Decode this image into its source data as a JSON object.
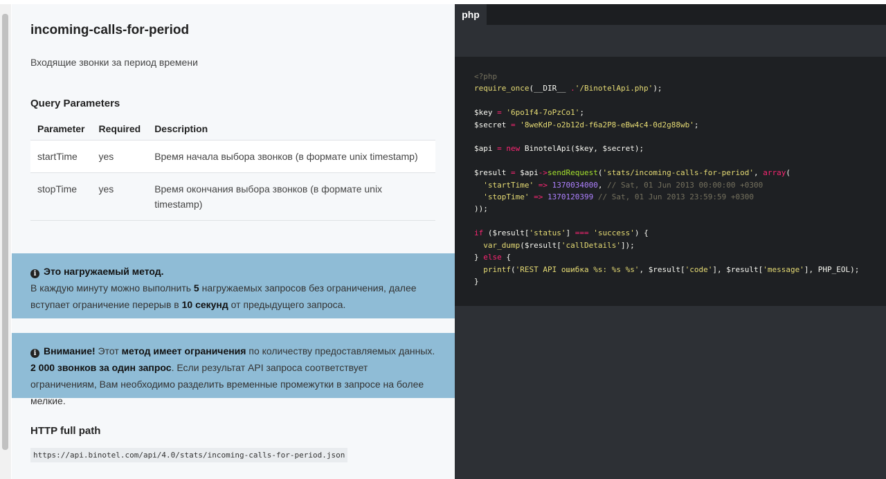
{
  "page": {
    "title": "incoming-calls-for-period",
    "subtitle": "Входящие звонки за период времени"
  },
  "query_params": {
    "heading": "Query Parameters",
    "columns": [
      "Parameter",
      "Required",
      "Description"
    ],
    "rows": [
      {
        "parameter": "startTime",
        "required": "yes",
        "description": "Время начала выбора звонков (в формате unix timestamp)"
      },
      {
        "parameter": "stopTime",
        "required": "yes",
        "description": "Время окончания выбора звонков (в формате unix timestamp)"
      }
    ]
  },
  "notice_load": {
    "icon": "info-icon",
    "title": "Это нагружаемый метод.",
    "text_1": "В каждую минуту можно выполнить ",
    "requests": "5",
    "text_2": " нагружаемых запросов без ограничения, далее вступает ограничение перерыв в ",
    "pause": "10 секунд",
    "text_3": " от предыдущего запроса."
  },
  "notice_limit": {
    "icon": "info-icon",
    "title": "Внимание!",
    "text_1": " Этот ",
    "bold_1": "метод имеет ограничения",
    "text_2": " по количеству предоставляемых данных. ",
    "bold_2": "2 000 звонков за один запрос",
    "text_3": ". Если результат API запроса соответствует ограничениям, Вам необходимо разделить временные промежутки в запросе на более мелкие."
  },
  "http_path": {
    "heading": "HTTP full path",
    "url": "https://api.binotel.com/api/4.0/stats/incoming-calls-for-period.json"
  },
  "code_panel": {
    "tab_label": "php",
    "lines": {
      "open_tag": "<?php",
      "require_fn": "require_once",
      "require_const": "__DIR__",
      "require_path": "'/BinotelApi.php'",
      "key_var": "$key",
      "key_val": "'6po1f4-7oPzCo1'",
      "secret_var": "$secret",
      "secret_val": "'8weKdP-o2b12d-f6a2P8-eBw4c4-0d2g88wb'",
      "api_var": "$api",
      "new_kw": "new",
      "api_class": "BinotelApi($key, $secret);",
      "result_var": "$result",
      "send_fn": "sendRequest",
      "endpoint": "'stats/incoming-calls-for-period'",
      "array_kw": "array",
      "start_key": "'startTime'",
      "start_val": "1370034000",
      "start_comment": "// Sat, 01 Jun 2013 00:00:00 +0300",
      "stop_key": "'stopTime'",
      "stop_val": "1370120399",
      "stop_comment": "// Sat, 01 Jun 2013 23:59:59 +0300",
      "if_kw": "if",
      "status_key": "'status'",
      "success_val": "'success'",
      "dump_fn": "var_dump",
      "details_key": "'callDetails'",
      "else_kw": "else",
      "printf_fn": "printf",
      "printf_fmt": "'REST API ошибка %s: %s %s'",
      "code_key": "'code'",
      "message_key": "'message'",
      "eol_const": "PHP_EOL"
    }
  },
  "colors": {
    "notice_bg": "#8fbcd6",
    "code_bg": "#1e2023",
    "panel_bg": "#2d3035"
  }
}
